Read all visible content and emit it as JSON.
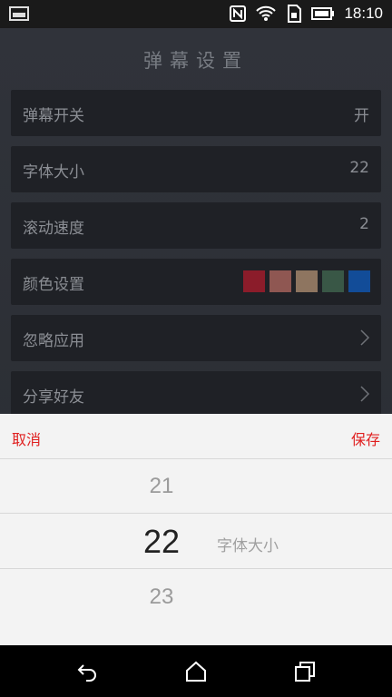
{
  "status_bar": {
    "time": "18:10"
  },
  "page": {
    "title": "弹幕设置"
  },
  "settings": {
    "danmaku_toggle": {
      "label": "弹幕开关",
      "value": "开"
    },
    "font_size": {
      "label": "字体大小",
      "value": "22"
    },
    "scroll_speed": {
      "label": "滚动速度",
      "value": "2"
    },
    "color": {
      "label": "颜色设置",
      "swatches": [
        "#8b1c2a",
        "#8f5752",
        "#8e7560",
        "#395746",
        "#124c98"
      ]
    },
    "ignore_apps": {
      "label": "忽略应用"
    },
    "share": {
      "label": "分享好友"
    }
  },
  "picker": {
    "cancel_label": "取消",
    "save_label": "保存",
    "prev_value": "21",
    "selected_value": "22",
    "next_value": "23",
    "unit_label": "字体大小"
  },
  "nav_bar": {
    "icons": [
      "back-icon",
      "home-icon",
      "recents-icon"
    ]
  }
}
